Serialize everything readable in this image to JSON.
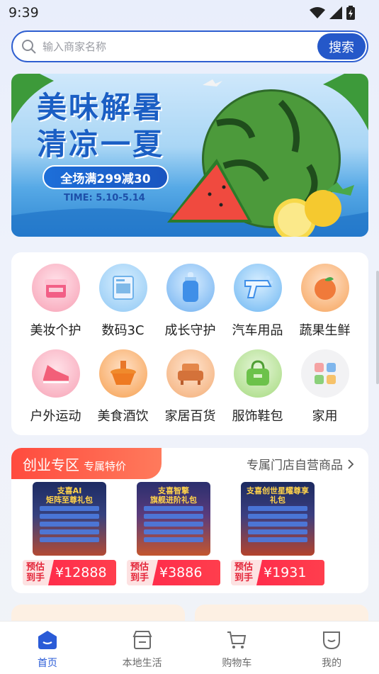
{
  "status": {
    "time": "9:39"
  },
  "search": {
    "placeholder": "输入商家名称",
    "button": "搜索"
  },
  "banner": {
    "title_line1": "美味解暑",
    "title_line2": "清凉一夏",
    "promo": "全场满299减30",
    "time": "TIME:  5.10-5.14"
  },
  "categories": [
    {
      "label": "美妆个护",
      "icon": "cosmetics-icon",
      "color": "#f56b8a"
    },
    {
      "label": "数码3C",
      "icon": "appliance-icon",
      "color": "#4aa3ec"
    },
    {
      "label": "成长守护",
      "icon": "baby-bottle-icon",
      "color": "#3f8fe8"
    },
    {
      "label": "汽车用品",
      "icon": "car-wash-icon",
      "color": "#3f8fe8"
    },
    {
      "label": "蔬果生鲜",
      "icon": "peach-icon",
      "color": "#f08a3c"
    },
    {
      "label": "户外运动",
      "icon": "sneaker-icon",
      "color": "#f56b8a"
    },
    {
      "label": "美食酒饮",
      "icon": "hotpot-icon",
      "color": "#f0892c"
    },
    {
      "label": "家居百货",
      "icon": "sofa-icon",
      "color": "#e4874a"
    },
    {
      "label": "服饰鞋包",
      "icon": "handbag-icon",
      "color": "#6cc24a"
    },
    {
      "label": "家用",
      "icon": "grid-icon",
      "color": "#f2f2f2"
    }
  ],
  "business": {
    "title": "创业专区",
    "subtitle": "专属特价",
    "more": "专属门店自营商品",
    "items": [
      {
        "img_title": "支喜AI\n矩阵至尊礼包",
        "price_tag_1": "预估",
        "price_tag_2": "到手",
        "price": "¥12888"
      },
      {
        "img_title": "支喜智擎\n旗舰进阶礼包",
        "price_tag_1": "预估",
        "price_tag_2": "到手",
        "price": "¥3886"
      },
      {
        "img_title": "支喜创世星耀尊享礼包",
        "price_tag_1": "预估",
        "price_tag_2": "到手",
        "price": "¥1931"
      }
    ]
  },
  "tabs": [
    {
      "label": "首页",
      "icon": "home-icon",
      "active": true
    },
    {
      "label": "本地生活",
      "icon": "store-icon",
      "active": false
    },
    {
      "label": "购物车",
      "icon": "cart-icon",
      "active": false
    },
    {
      "label": "我的",
      "icon": "profile-icon",
      "active": false
    }
  ],
  "colors": {
    "accent": "#2558c9",
    "price_red": "#ff2d4b",
    "promo_orange": "#ff4b3e"
  }
}
